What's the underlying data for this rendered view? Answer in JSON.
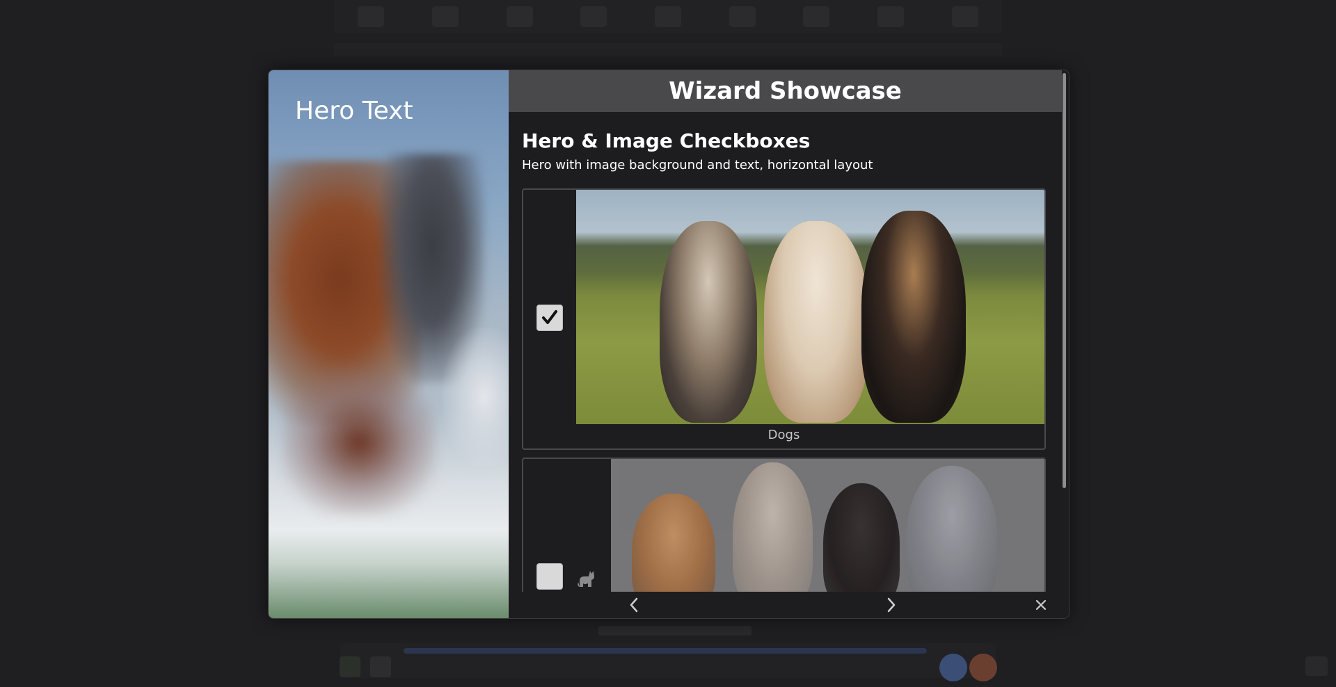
{
  "modal": {
    "hero_text": "Hero Text",
    "title": "Wizard Showcase",
    "section": {
      "heading": "Hero & Image Checkboxes",
      "description": "Hero with image background and text, horizontal layout"
    },
    "options": [
      {
        "label": "Dogs",
        "checked": true,
        "icon": "check-icon"
      },
      {
        "label": "",
        "checked": false,
        "icon": "cat-icon"
      }
    ],
    "footer": {
      "prev_icon": "chevron-left-icon",
      "next_icon": "chevron-right-icon",
      "close_icon": "close-icon"
    }
  }
}
